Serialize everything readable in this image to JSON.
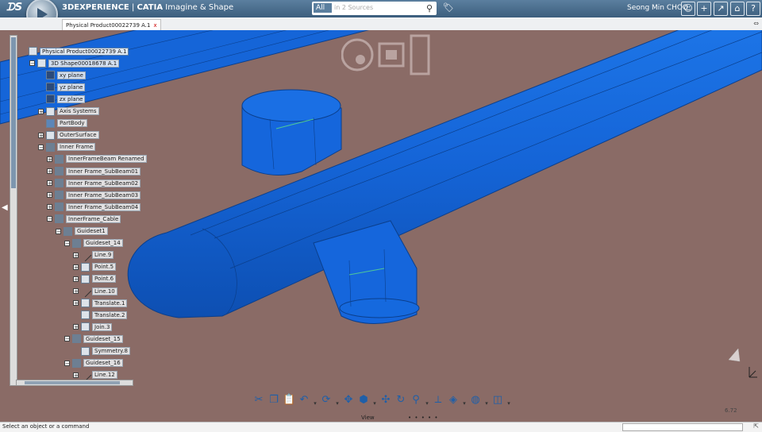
{
  "header": {
    "brand": "3DEXPERIENCE",
    "separator": " | ",
    "app_bold": "CATIA",
    "app_name": "Imagine & Shape",
    "search_scope": "All",
    "search_placeholder": "in 2 Sources",
    "user": "Seong Min CHOO"
  },
  "tab": {
    "label": "Physical Product00022739 A.1",
    "close": "x"
  },
  "tree": {
    "nodes": [
      {
        "label": "Physical Product00022739 A.1",
        "level": 0,
        "exp": "",
        "icon": "product-icon",
        "sel": true
      },
      {
        "label": "3D Shape00018678 A.1",
        "level": 1,
        "exp": "−",
        "icon": "shape-icon",
        "sel": false
      },
      {
        "label": "xy plane",
        "level": 2,
        "exp": "",
        "icon": "plane-icon",
        "sel": false
      },
      {
        "label": "yz plane",
        "level": 2,
        "exp": "",
        "icon": "plane-icon",
        "sel": false
      },
      {
        "label": "zx plane",
        "level": 2,
        "exp": "",
        "icon": "plane-icon",
        "sel": false
      },
      {
        "label": "Axis Systems",
        "level": 2,
        "exp": "+",
        "icon": "axis-icon",
        "sel": false
      },
      {
        "label": "PartBody",
        "level": 2,
        "exp": "",
        "icon": "body-icon",
        "sel": false
      },
      {
        "label": "OuterSurface",
        "level": 2,
        "exp": "+",
        "icon": "surface-icon",
        "sel": false
      },
      {
        "label": "Inner Frame",
        "level": 2,
        "exp": "−",
        "icon": "geoset-icon",
        "sel": false
      },
      {
        "label": "InnerFrameBeam Renamed",
        "level": 3,
        "exp": "+",
        "icon": "beam-icon",
        "sel": false
      },
      {
        "label": "Inner Frame_SubBeam01",
        "level": 3,
        "exp": "+",
        "icon": "beam-icon",
        "sel": false
      },
      {
        "label": "Inner Frame_SubBeam02",
        "level": 3,
        "exp": "+",
        "icon": "beam-icon",
        "sel": false
      },
      {
        "label": "Inner Frame_SubBeam03",
        "level": 3,
        "exp": "+",
        "icon": "beam-icon",
        "sel": false
      },
      {
        "label": "Inner Frame_SubBeam04",
        "level": 3,
        "exp": "+",
        "icon": "beam-icon",
        "sel": false
      },
      {
        "label": "InnerFrame_Cable",
        "level": 3,
        "exp": "−",
        "icon": "geoset-icon",
        "sel": false
      },
      {
        "label": "Guideset1",
        "level": 4,
        "exp": "−",
        "icon": "geoset-icon",
        "sel": false
      },
      {
        "label": "Guideset_14",
        "level": 5,
        "exp": "−",
        "icon": "geoset-icon",
        "sel": false
      },
      {
        "label": "Line.9",
        "level": 6,
        "exp": "+",
        "icon": "line-icon",
        "sel": false
      },
      {
        "label": "Point.5",
        "level": 6,
        "exp": "+",
        "icon": "point-icon",
        "sel": false
      },
      {
        "label": "Point.6",
        "level": 6,
        "exp": "+",
        "icon": "point-icon",
        "sel": false
      },
      {
        "label": "Line.10",
        "level": 6,
        "exp": "+",
        "icon": "line-icon",
        "sel": false
      },
      {
        "label": "Translate.1",
        "level": 6,
        "exp": "+",
        "icon": "translate-icon",
        "sel": false
      },
      {
        "label": "Translate.2",
        "level": 6,
        "exp": "",
        "icon": "translate-icon",
        "sel": false
      },
      {
        "label": "Join.3",
        "level": 6,
        "exp": "+",
        "icon": "join-icon",
        "sel": false
      },
      {
        "label": "Guideset_15",
        "level": 5,
        "exp": "−",
        "icon": "geoset-icon",
        "sel": false
      },
      {
        "label": "Symmetry.8",
        "level": 6,
        "exp": "",
        "icon": "symmetry-icon",
        "sel": false
      },
      {
        "label": "Guideset_16",
        "level": 5,
        "exp": "−",
        "icon": "geoset-icon",
        "sel": false
      },
      {
        "label": "Line.12",
        "level": 6,
        "exp": "+",
        "icon": "line-icon",
        "sel": false
      }
    ]
  },
  "toolbar": {
    "tools": [
      "cut-icon",
      "copy-icon",
      "paste-icon",
      "undo-icon",
      "drop",
      "rotate-view-icon",
      "drop",
      "fit-all-icon",
      "render-mode-icon",
      "drop",
      "pan-icon",
      "rotate-icon",
      "zoom-icon",
      "drop",
      "normal-view-icon",
      "iso-view-icon",
      "drop",
      "hide-show-icon",
      "drop",
      "split-view-icon",
      "drop"
    ],
    "glyphs": {
      "cut-icon": "✂",
      "copy-icon": "❐",
      "paste-icon": "📋",
      "undo-icon": "↶",
      "drop": "▾",
      "rotate-view-icon": "⟳",
      "fit-all-icon": "✥",
      "render-mode-icon": "⬢",
      "pan-icon": "✣",
      "rotate-icon": "↻",
      "zoom-icon": "⚲",
      "normal-view-icon": "⟂",
      "iso-view-icon": "◈",
      "hide-show-icon": "◍",
      "split-view-icon": "◫"
    },
    "section_label": "View",
    "pager": "• • • • •"
  },
  "version": "6.72",
  "status": {
    "text": "Select an object or a command"
  },
  "colors": {
    "background": "#8a6b66",
    "part": "#1565d8",
    "header": "#4a6d8c"
  }
}
